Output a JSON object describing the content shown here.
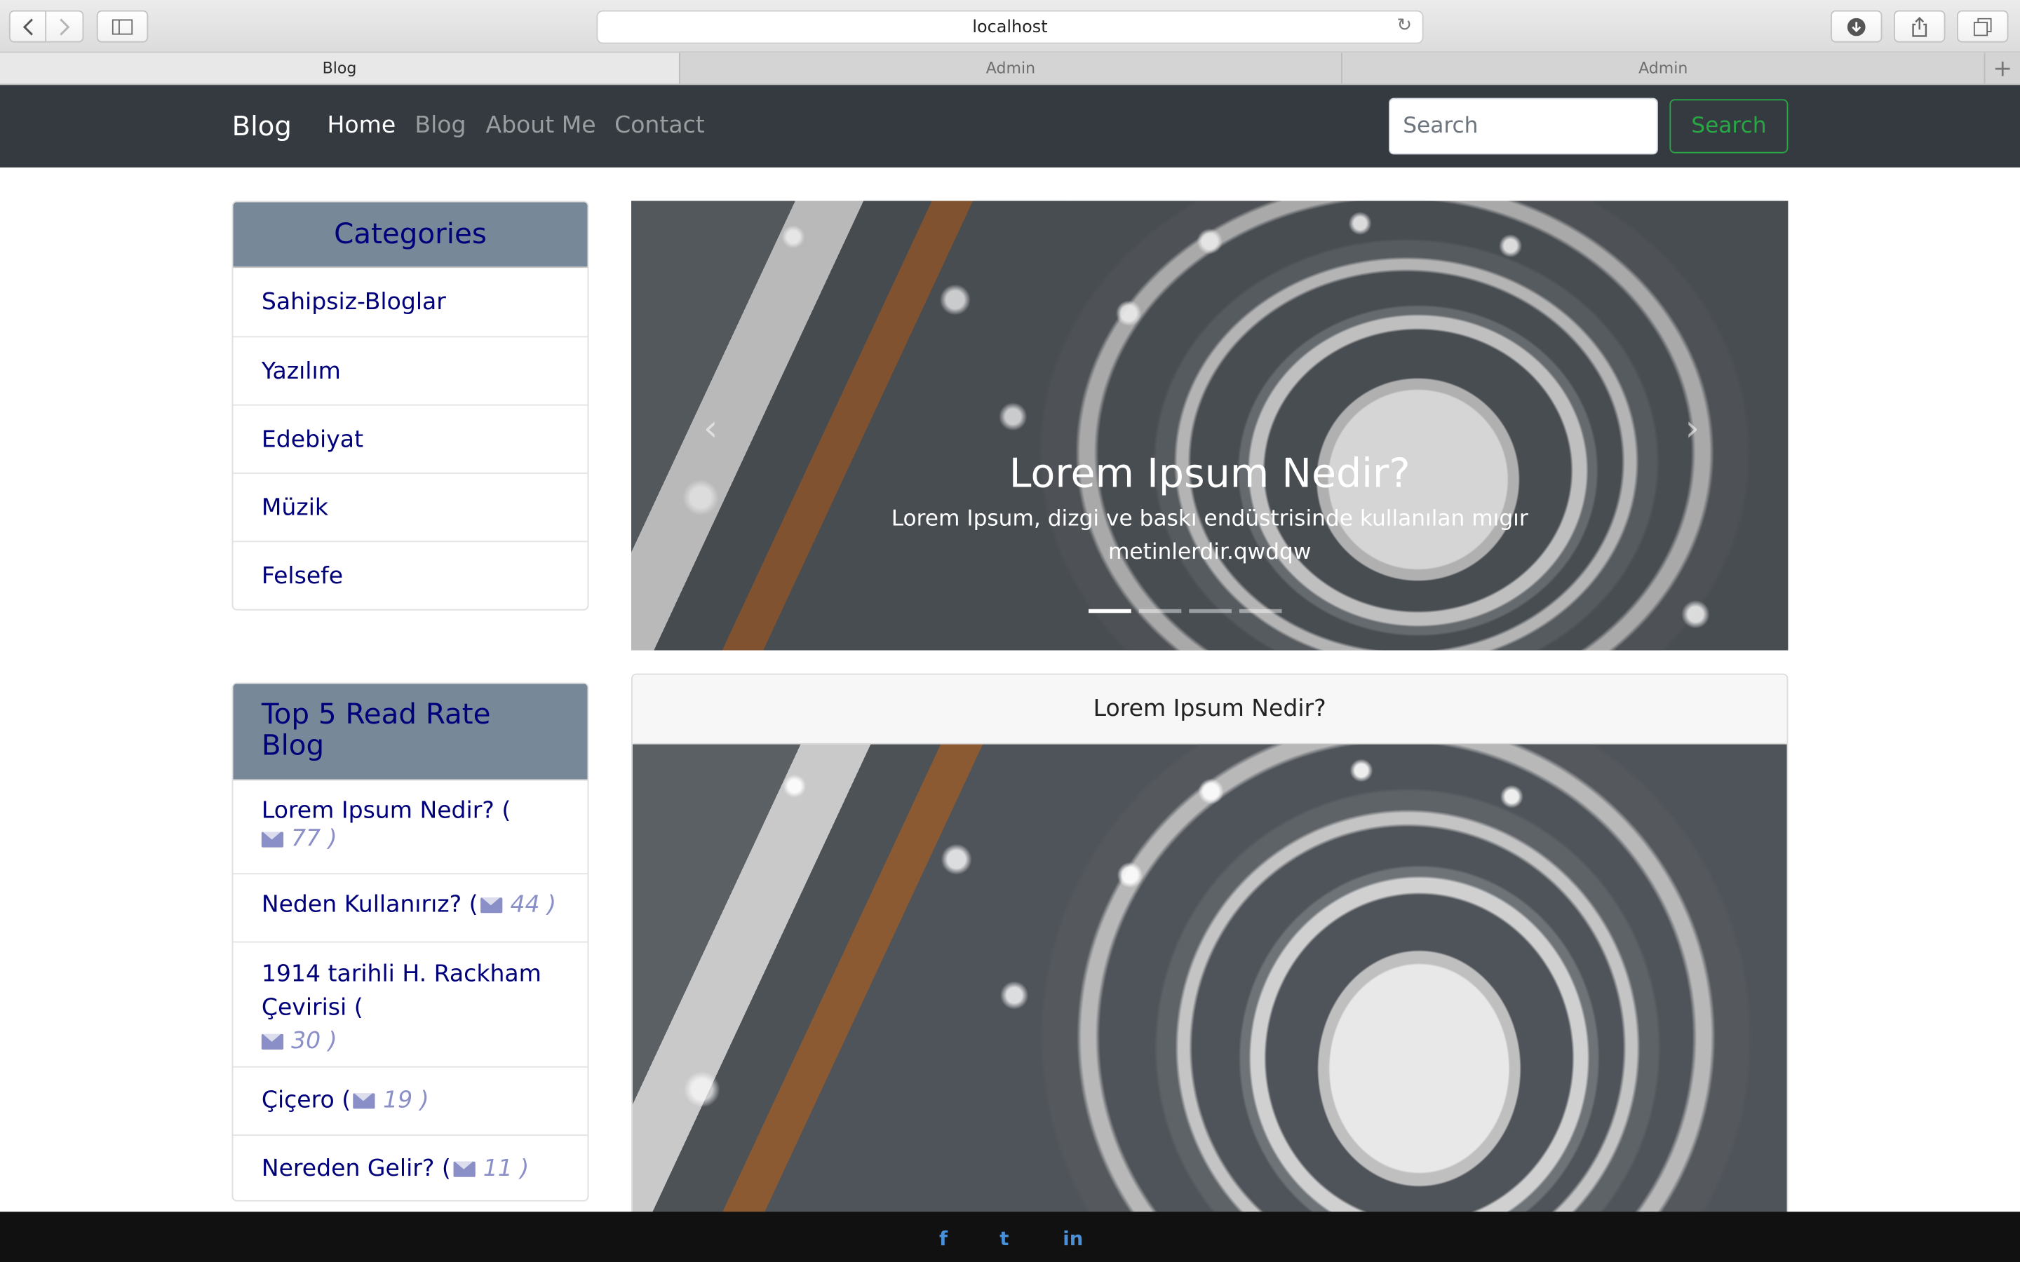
{
  "browser": {
    "url": "localhost",
    "tabs": [
      "Blog",
      "Admin",
      "Admin"
    ],
    "reload_icon": "↻",
    "new_tab_icon": "+"
  },
  "navbar": {
    "brand": "Blog",
    "links": [
      "Home",
      "Blog",
      "About Me",
      "Contact"
    ],
    "active_link": "Home",
    "search_placeholder": "Search",
    "search_button": "Search"
  },
  "categories": {
    "title": "Categories",
    "items": [
      "Sahipsiz-Bloglar",
      "Yazılım",
      "Edebiyat",
      "Müzik",
      "Felsefe"
    ]
  },
  "top_blogs": {
    "title": "Top 5 Read Rate Blog",
    "items": [
      {
        "title": "Lorem Ipsum Nedir? (",
        "count": "77",
        "close": ")"
      },
      {
        "title": "Neden Kullanırız? (",
        "count": "44",
        "close": ")"
      },
      {
        "title": "1914 tarihli H. Rackham Çevirisi (",
        "count": "30",
        "close": ")"
      },
      {
        "title": "Çiçero (",
        "count": "19",
        "close": ")"
      },
      {
        "title": "Nereden Gelir? (",
        "count": "11",
        "close": ")"
      }
    ]
  },
  "carousel": {
    "title": "Lorem Ipsum Nedir?",
    "text": "Lorem Ipsum, dizgi ve baskı endüstrisinde kullanılan mıgır metinlerdir.qwdqw",
    "prev_icon": "‹",
    "next_icon": "›",
    "slide_count": 4,
    "active_slide": 1
  },
  "post": {
    "title": "Lorem Ipsum Nedir?"
  },
  "footer": {
    "social": [
      "f",
      "t",
      "in"
    ]
  },
  "colors": {
    "navbar_bg": "#343a40",
    "card_header_bg": "#778899",
    "link_navy": "#00007a",
    "search_green": "#28a745"
  }
}
